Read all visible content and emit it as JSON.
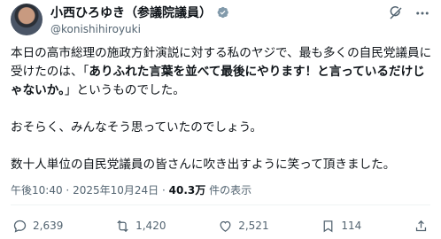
{
  "author": {
    "display_name": "小西ひろゆき（参議院議員）",
    "handle": "@konishihiroyuki"
  },
  "post": {
    "body_line1": "本日の高市総理の施政方針演説に対する私のヤジで、最も多くの自民党議員に受けたのは、「",
    "body_quote": "ありふれた言葉を並べて最後にやります！と言っているだけじゃないか。",
    "body_line1_tail": "」というものでした。",
    "paragraph2": "おそらく、みんなそう思っていたのでしょう。",
    "paragraph3": "数十人単位の自民党議員の皆さんに吹き出すように笑って頂きました。"
  },
  "meta": {
    "time": "午後10:40",
    "separator1": "·",
    "date": "2025年10月24日",
    "separator2": "·",
    "views_count": "40.3万",
    "views_label": " 件の表示"
  },
  "actions": {
    "replies": "2,639",
    "reposts": "1,420",
    "likes": "2,521",
    "bookmarks": "114"
  },
  "icons": {
    "verified": "verified-badge-icon",
    "grok": "grok-icon",
    "more": "more-icon",
    "reply": "reply-icon",
    "repost": "repost-icon",
    "like": "heart-icon",
    "bookmark": "bookmark-icon",
    "share": "share-icon"
  },
  "colors": {
    "verified": "#829aab",
    "secondary_text": "#536471",
    "primary_text": "#0f1419"
  }
}
